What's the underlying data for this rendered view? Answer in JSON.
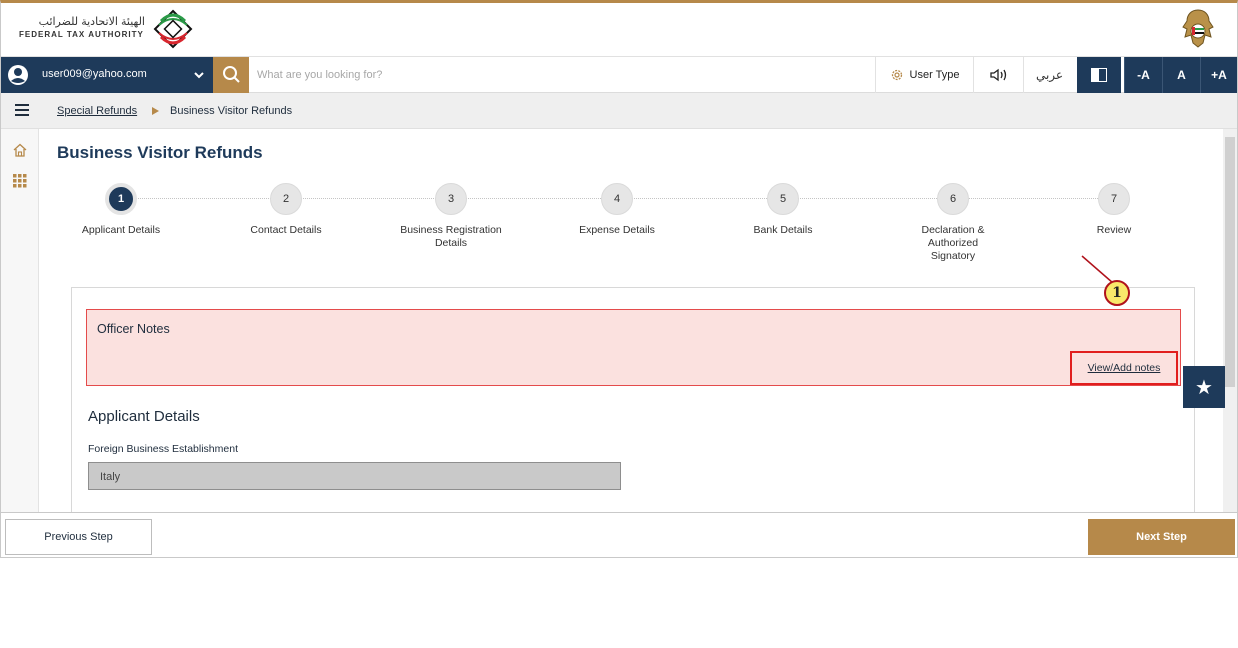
{
  "header": {
    "logo_arabic": "الهيئة الاتحادية للضرائب",
    "logo_english": "FEDERAL TAX AUTHORITY",
    "logo_icon": "fta-logo-icon",
    "emblem_icon": "uae-emblem-icon"
  },
  "toolbar": {
    "user_email": "user009@yahoo.com",
    "search_placeholder": "What are you looking for?",
    "user_type_label": "User Type",
    "language_label": "عربي",
    "font_decrease_label": "-A",
    "font_normal_label": "A",
    "font_increase_label": "+A"
  },
  "breadcrumb": {
    "parent": "Special Refunds",
    "current": "Business Visitor Refunds"
  },
  "page": {
    "title": "Business Visitor Refunds"
  },
  "stepper": {
    "active_step": 1,
    "steps": [
      {
        "number": "1",
        "label": "Applicant Details"
      },
      {
        "number": "2",
        "label": "Contact Details"
      },
      {
        "number": "3",
        "label": "Business Registration Details"
      },
      {
        "number": "4",
        "label": "Expense Details"
      },
      {
        "number": "5",
        "label": "Bank Details"
      },
      {
        "number": "6",
        "label": "Declaration & Authorized Signatory"
      },
      {
        "number": "7",
        "label": "Review"
      }
    ]
  },
  "officer_notes": {
    "title": "Officer Notes",
    "link_label": "View/Add notes",
    "callout_number": "1"
  },
  "applicant_details": {
    "section_title": "Applicant Details",
    "field_label": "Foreign Business Establishment",
    "field_value": "Italy"
  },
  "footer": {
    "previous_label": "Previous Step",
    "next_label": "Next Step"
  },
  "colors": {
    "primary_navy": "#1e3a5a",
    "accent_gold": "#b6894a",
    "notes_background": "#fbe1df",
    "notes_border": "#e44b4b",
    "highlight_red": "#e11e1e"
  }
}
